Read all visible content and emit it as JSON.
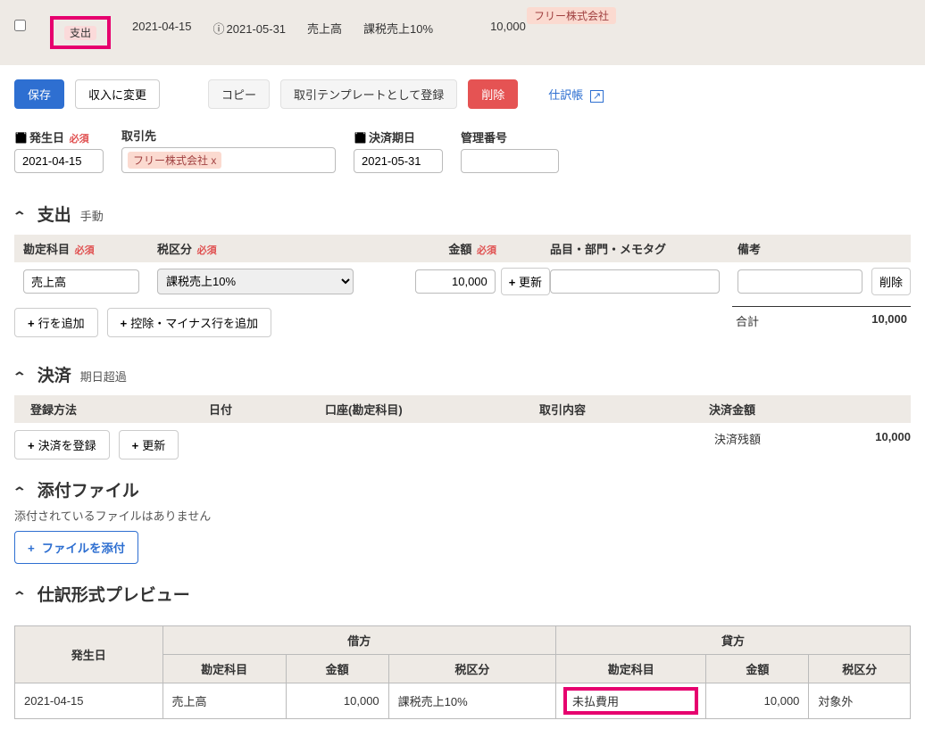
{
  "summary": {
    "type_chip": "支出",
    "date": "2021-04-15",
    "due": "2021-05-31",
    "account": "売上高",
    "tax": "課税売上10%",
    "amount": "10,000",
    "partner_tag": "フリー株式会社"
  },
  "actions": {
    "save": "保存",
    "switch": "収入に変更",
    "copy": "コピー",
    "template": "取引テンプレートとして登録",
    "delete": "削除",
    "journal_link": "仕訳帳"
  },
  "form": {
    "date_label": "発生日",
    "date_value": "2021-04-15",
    "partner_label": "取引先",
    "partner_chip": "フリー株式会社 x",
    "due_label": "決済期日",
    "due_value": "2021-05-31",
    "mgmt_label": "管理番号",
    "mgmt_value": "",
    "required": "必須"
  },
  "expense": {
    "heading": "支出",
    "sub": "手動",
    "col_account": "勘定科目",
    "col_tax": "税区分",
    "col_amount": "金額",
    "col_tags": "品目・部門・メモタグ",
    "col_note": "備考",
    "col_delete": "削除",
    "row": {
      "account": "売上高",
      "tax": "課税売上10%",
      "amount": "10,000",
      "update": "更新",
      "tags": "",
      "note": ""
    },
    "add_row": "行を追加",
    "add_neg": "控除・マイナス行を追加",
    "total_label": "合計",
    "total_value": "10,000"
  },
  "settlement": {
    "heading": "決済",
    "sub": "期日超過",
    "col_method": "登録方法",
    "col_date": "日付",
    "col_account": "口座(勘定科目)",
    "col_desc": "取引内容",
    "col_amount": "決済金額",
    "add": "決済を登録",
    "refresh": "更新",
    "balance_label": "決済残額",
    "balance_value": "10,000"
  },
  "attachments": {
    "heading": "添付ファイル",
    "empty": "添付されているファイルはありません",
    "attach": "ファイルを添付"
  },
  "journal": {
    "heading": "仕訳形式プレビュー",
    "h_date": "発生日",
    "h_debit": "借方",
    "h_credit": "貸方",
    "h_account": "勘定科目",
    "h_amount": "金額",
    "h_tax": "税区分",
    "date": "2021-04-15",
    "d_account": "売上高",
    "d_amount": "10,000",
    "d_tax": "課税売上10%",
    "c_account": "未払費用",
    "c_amount": "10,000",
    "c_tax": "対象外"
  }
}
